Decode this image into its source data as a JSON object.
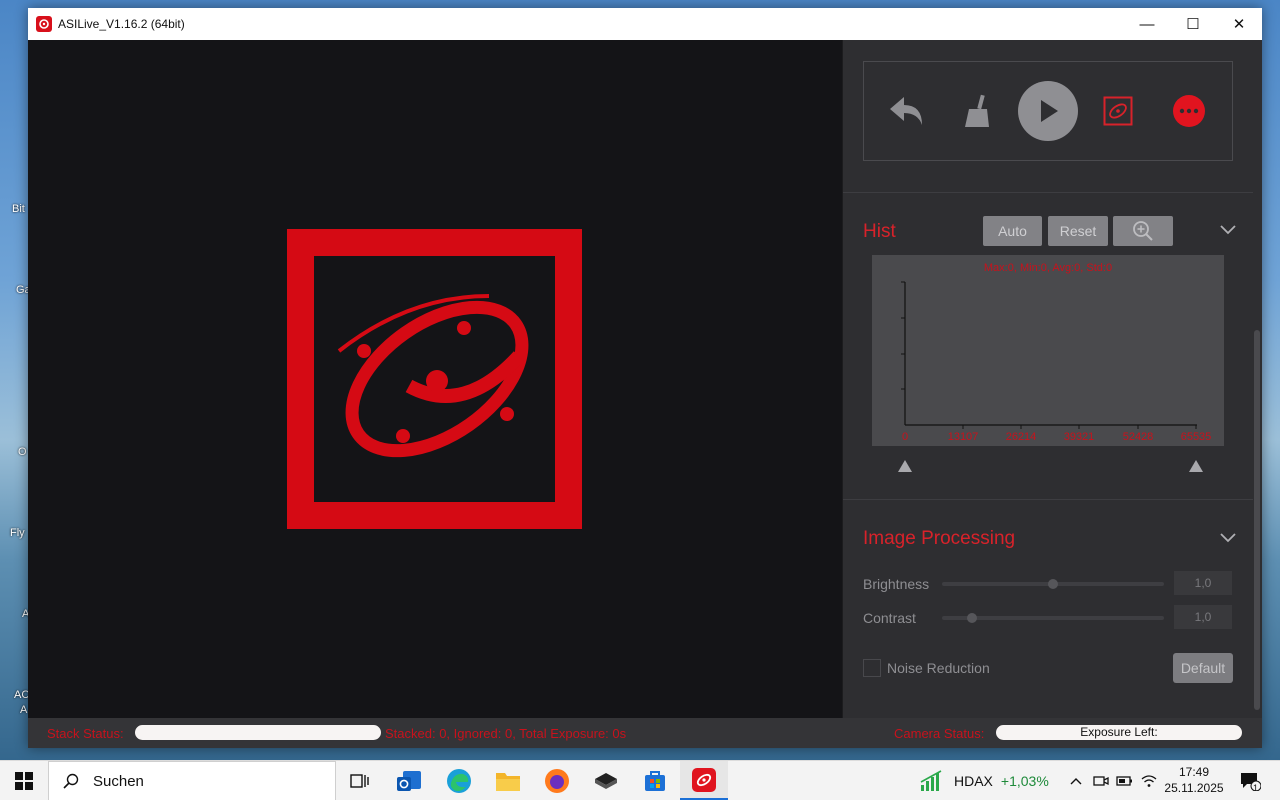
{
  "desktop": {
    "fragments": [
      "Bit",
      "Ga",
      "O",
      "Fly",
      "A",
      "AC",
      "A"
    ]
  },
  "window": {
    "title": "ASILive_V1.16.2 (64bit)",
    "controls": {
      "minimize": "—",
      "maximize": "☐",
      "close": "✕"
    }
  },
  "toolbar": {
    "icons": [
      "undo-icon",
      "broom-icon",
      "play-icon",
      "asi-logo-icon",
      "more-icon"
    ],
    "colors": {
      "accent": "#d8222a",
      "muted": "#8f8f93"
    }
  },
  "hist": {
    "title": "Hist",
    "auto_label": "Auto",
    "reset_label": "Reset",
    "stats": "Max:0, Min:0, Avg:0, Std:0",
    "ticks": [
      "0",
      "13107",
      "26214",
      "39321",
      "52428",
      "65535"
    ]
  },
  "processing": {
    "title": "Image Processing",
    "brightness_label": "Brightness",
    "brightness_value": "1,0",
    "brightness_level": 0.5,
    "contrast_label": "Contrast",
    "contrast_value": "1,0",
    "contrast_level": 0.12,
    "noise_label": "Noise Reduction",
    "default_label": "Default"
  },
  "status": {
    "stack_label": "Stack Status:",
    "stack_text": "Stacked: 0, Ignored: 0, Total Exposure: 0s",
    "camera_label": "Camera Status:",
    "exposure_left": "Exposure Left:"
  },
  "taskbar": {
    "search_placeholder": "Suchen",
    "stock_name": "HDAX",
    "stock_change": "+1,03%",
    "time": "17:49",
    "date": "25.11.2025",
    "notification_count": "1"
  }
}
